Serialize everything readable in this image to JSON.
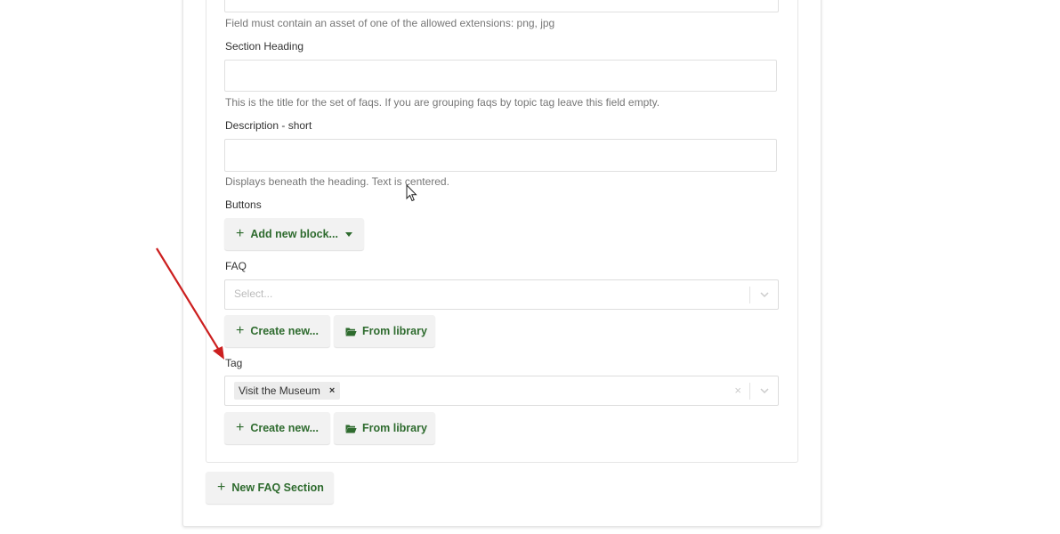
{
  "image_field": {
    "hint": "Field must contain an asset of one of the allowed extensions: png, jpg"
  },
  "section_heading": {
    "label": "Section Heading",
    "value": "",
    "hint": "This is the title for the set of faqs. If you are grouping faqs by topic tag leave this field empty."
  },
  "description_short": {
    "label": "Description - short",
    "value": "",
    "hint": "Displays beneath the heading. Text is centered."
  },
  "buttons": {
    "label": "Buttons",
    "add_block_label": "Add new block..."
  },
  "faq": {
    "label": "FAQ",
    "placeholder": "Select...",
    "create_label": "Create new...",
    "library_label": "From library"
  },
  "tag": {
    "label": "Tag",
    "selected": [
      "Visit the Museum"
    ],
    "create_label": "Create new...",
    "library_label": "From library"
  },
  "new_section": {
    "label": "New FAQ Section"
  },
  "colors": {
    "accent_green": "#2e6b2e",
    "annotation_arrow": "#cc1f1f"
  },
  "icons": [
    "plus-icon",
    "caret-down-icon",
    "folder-open-icon",
    "chevron-down-icon",
    "remove-tag-icon",
    "clear-icon",
    "mouse-cursor-icon",
    "annotation-arrow"
  ]
}
